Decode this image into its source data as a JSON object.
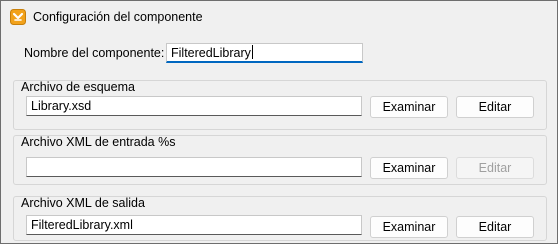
{
  "window": {
    "title": "Configuración del componente",
    "icon": "altova-mapforce-icon"
  },
  "component_name": {
    "label": "Nombre del componente:",
    "value": "FilteredLibrary"
  },
  "schema_file": {
    "group_label": "Archivo de esquema",
    "value": "Library.xsd",
    "browse_label": "Examinar",
    "edit_label": "Editar"
  },
  "input_xml_file": {
    "group_label": "Archivo XML de entrada %s",
    "value": "",
    "browse_label": "Examinar",
    "edit_label": "Editar",
    "edit_enabled": false
  },
  "output_xml_file": {
    "group_label": "Archivo XML de salida",
    "value": "FilteredLibrary.xml",
    "browse_label": "Examinar",
    "edit_label": "Editar"
  }
}
